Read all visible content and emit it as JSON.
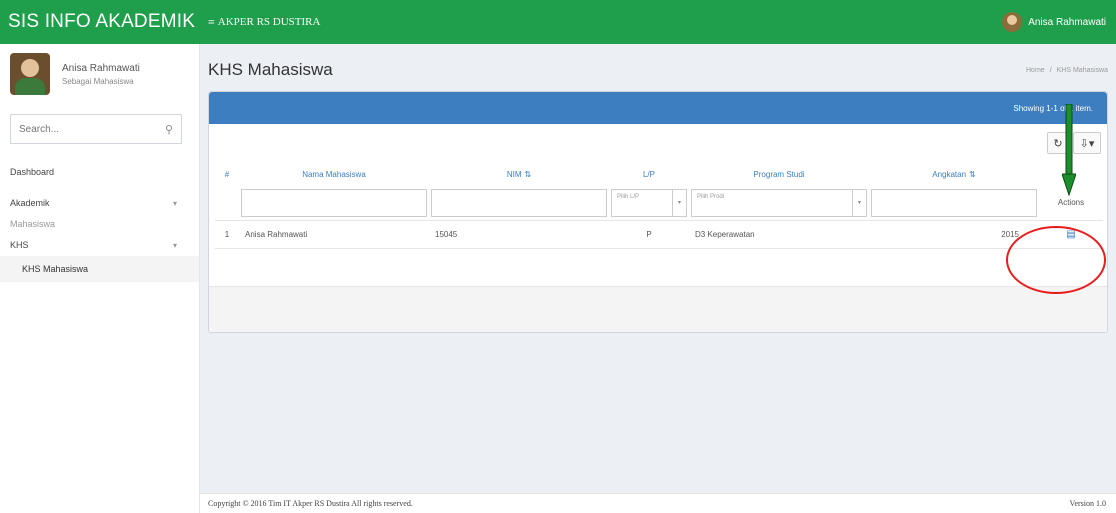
{
  "topbar": {
    "brand": "SIS INFO AKADEMIK",
    "menu_label": "AKPER RS DUSTIRA",
    "user_name": "Anisa Rahmawati"
  },
  "sidebar": {
    "user_name": "Anisa Rahmawati",
    "user_role": "Sebagai Mahasiswa",
    "search_placeholder": "Search...",
    "items": [
      {
        "label": "Dashboard"
      },
      {
        "label": "Akademik"
      },
      {
        "label": "Mahasiswa"
      },
      {
        "label": "KHS"
      },
      {
        "label": "KHS Mahasiswa"
      }
    ]
  },
  "header": {
    "title": "KHS Mahasiswa",
    "breadcrumb_home": "Home",
    "breadcrumb_current": "KHS Mahasiswa"
  },
  "box": {
    "showing": "Showing 1-1 of 1 item.",
    "columns": {
      "num": "#",
      "nama": "Nama Mahasiswa",
      "nim": "NIM",
      "lp": "L/P",
      "prodi": "Program Studi",
      "angkatan": "Angkatan",
      "actions": "Actions"
    },
    "filters": {
      "lp": "Pilih L/P",
      "prodi": "Pilih Prodi"
    },
    "rows": [
      {
        "num": "1",
        "nama": "Anisa Rahmawati",
        "nim": "15045",
        "lp": "P",
        "prodi": "D3 Keperawatan",
        "angkatan": "2015"
      }
    ]
  },
  "footer": {
    "copyright": "Copyright © 2016 Tim IT Akper RS Dustira All rights reserved.",
    "version": "Version 1.0"
  },
  "colors": {
    "topbar": "#1f9e4b",
    "box_header": "#3c7ebf",
    "annotation_circle": "#e81d1d",
    "annotation_arrow": "#1a8f2c"
  }
}
